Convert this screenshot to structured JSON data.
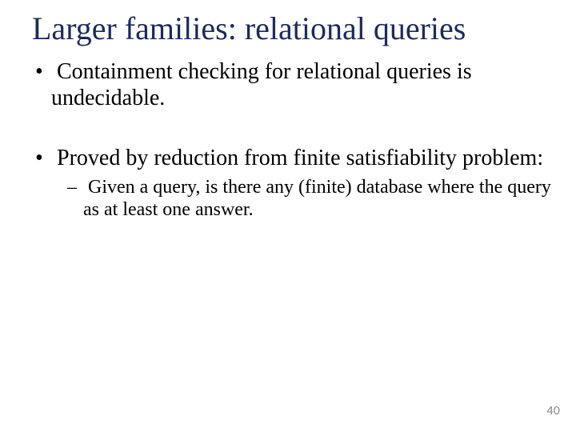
{
  "slide": {
    "title": "Larger families: relational queries",
    "bullets": [
      {
        "text": "Containment checking for relational queries is undecidable.",
        "sub": []
      },
      {
        "text": "Proved by reduction from finite satisfiability problem:",
        "sub": [
          "Given a query, is there any (finite) database where the query as at least one answer."
        ]
      }
    ],
    "page_number": "40"
  }
}
